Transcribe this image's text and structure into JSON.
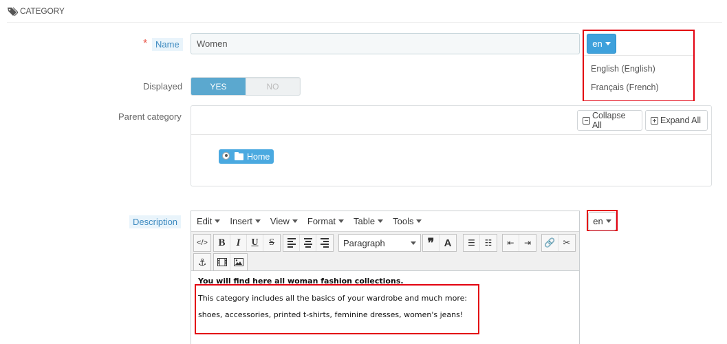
{
  "section": {
    "icon": "tags-icon",
    "title": "CATEGORY"
  },
  "name_field": {
    "required_mark": "*",
    "label": "Name",
    "value": "Women"
  },
  "name_language": {
    "button": "en",
    "options": [
      "English (English)",
      "Français (French)"
    ]
  },
  "displayed": {
    "label": "Displayed",
    "yes": "YES",
    "no": "NO",
    "selected": "YES"
  },
  "parent_category": {
    "label": "Parent category",
    "collapse_all": "Collapse All",
    "expand_all": "Expand All",
    "root_node": "Home"
  },
  "description": {
    "label": "Description",
    "language_button": "en",
    "menu": [
      "Edit",
      "Insert",
      "View",
      "Format",
      "Table",
      "Tools"
    ],
    "format_select": "Paragraph",
    "lines": [
      "You will find here all woman fashion collections.",
      "This category includes all the basics of your wardrobe and much more:",
      "shoes, accessories, printed t-shirts, feminine dresses, women's jeans!"
    ]
  },
  "colors": {
    "accent": "#3ea1dc",
    "highlight_border": "#e3000f",
    "required": "#e84e40",
    "toggle_on": "#5ba8cf"
  }
}
